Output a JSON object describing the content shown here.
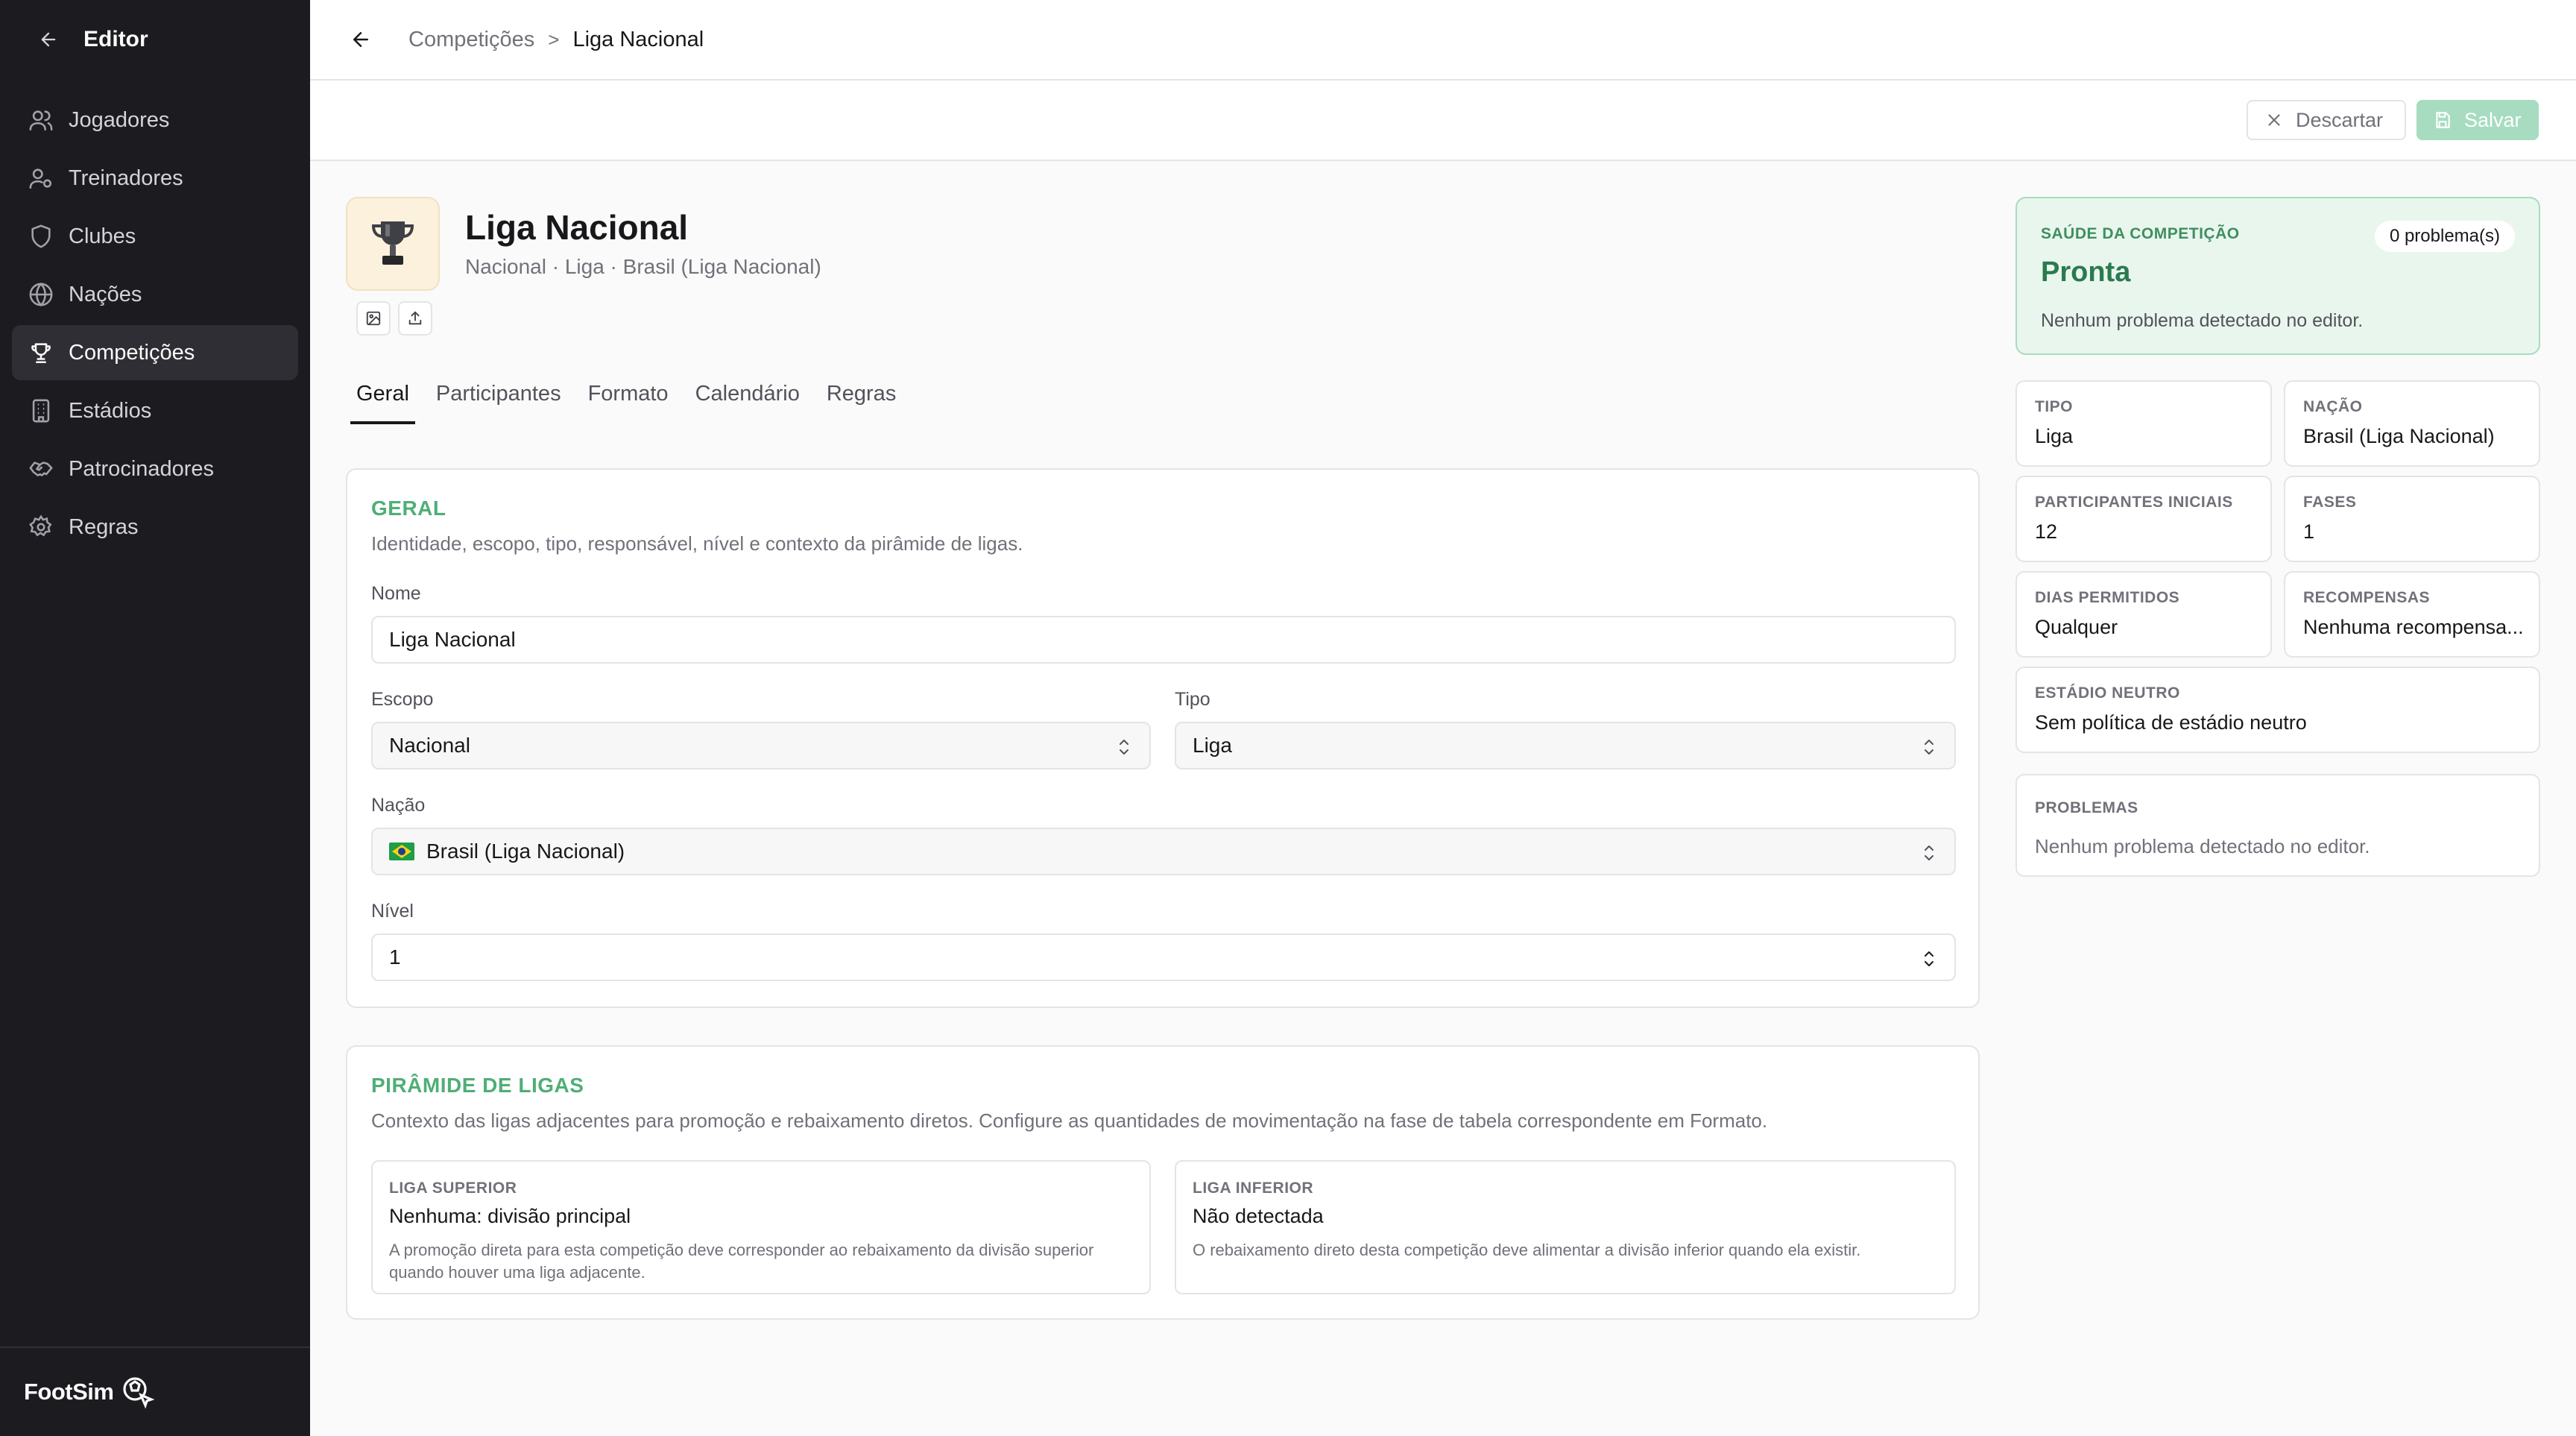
{
  "sidebar": {
    "title": "Editor",
    "items": [
      {
        "label": "Jogadores",
        "icon": "users-icon"
      },
      {
        "label": "Treinadores",
        "icon": "user-cog-icon"
      },
      {
        "label": "Clubes",
        "icon": "shield-icon"
      },
      {
        "label": "Nações",
        "icon": "globe-icon"
      },
      {
        "label": "Competições",
        "icon": "trophy-icon",
        "active": true
      },
      {
        "label": "Estádios",
        "icon": "building-icon"
      },
      {
        "label": "Patrocinadores",
        "icon": "handshake-icon"
      },
      {
        "label": "Regras",
        "icon": "gear-icon"
      }
    ],
    "brand": "FootSim"
  },
  "breadcrumb": {
    "parent": "Competições",
    "separator": ">",
    "current": "Liga Nacional"
  },
  "actions": {
    "discard": "Descartar",
    "save": "Salvar"
  },
  "competition": {
    "name": "Liga Nacional",
    "subtitle": "Nacional · Liga · Brasil (Liga Nacional)"
  },
  "tabs": [
    "Geral",
    "Participantes",
    "Formato",
    "Calendário",
    "Regras"
  ],
  "active_tab": "Geral",
  "geral": {
    "title": "GERAL",
    "description": "Identidade, escopo, tipo, responsável, nível e contexto da pirâmide de ligas.",
    "nome_label": "Nome",
    "nome_value": "Liga Nacional",
    "escopo_label": "Escopo",
    "escopo_value": "Nacional",
    "tipo_label": "Tipo",
    "tipo_value": "Liga",
    "nacao_label": "Nação",
    "nacao_value": "Brasil (Liga Nacional)",
    "nivel_label": "Nível",
    "nivel_value": "1"
  },
  "piramide": {
    "title": "PIRÂMIDE DE LIGAS",
    "description": "Contexto das ligas adjacentes para promoção e rebaixamento diretos. Configure as quantidades de movimentação na fase de tabela correspondente em Formato.",
    "superior_label": "LIGA SUPERIOR",
    "superior_value": "Nenhuma: divisão principal",
    "superior_desc": "A promoção direta para esta competição deve corresponder ao rebaixamento da divisão superior quando houver uma liga adjacente.",
    "inferior_label": "LIGA INFERIOR",
    "inferior_value": "Não detectada",
    "inferior_desc": "O rebaixamento direto desta competição deve alimentar a divisão inferior quando ela existir."
  },
  "health": {
    "label": "SAÚDE DA COMPETIÇÃO",
    "status": "Pronta",
    "badge": "0 problema(s)",
    "description": "Nenhum problema detectado no editor."
  },
  "stats": {
    "tipo_label": "TIPO",
    "tipo_value": "Liga",
    "nacao_label": "NAÇÃO",
    "nacao_value": "Brasil (Liga Nacional)",
    "participantes_label": "PARTICIPANTES INICIAIS",
    "participantes_value": "12",
    "fases_label": "FASES",
    "fases_value": "1",
    "dias_label": "DIAS PERMITIDOS",
    "dias_value": "Qualquer",
    "recompensas_label": "RECOMPENSAS",
    "recompensas_value": "Nenhuma recompensa...",
    "estadio_label": "ESTÁDIO NEUTRO",
    "estadio_value": "Sem política de estádio neutro"
  },
  "problemas": {
    "label": "PROBLEMAS",
    "text": "Nenhum problema detectado no editor."
  },
  "colors": {
    "accent_green": "#4fae77",
    "sidebar_bg": "#1c1c20",
    "health_bg": "#e9f6ee"
  }
}
